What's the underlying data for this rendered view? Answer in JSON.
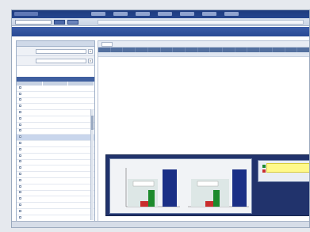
{
  "app": {
    "brand": "",
    "nav": [
      "",
      "",
      "",
      "",
      "",
      "",
      ""
    ]
  },
  "toolbar": {
    "select_value": "",
    "btn1": "",
    "btn2": ""
  },
  "section": {
    "menu": "",
    "title": ""
  },
  "left_panel": {
    "header": "",
    "filters": [
      {
        "label": "",
        "value": ""
      },
      {
        "label": "",
        "value": ""
      }
    ],
    "list_header": "",
    "columns": [
      "",
      "",
      ""
    ],
    "rows": [
      {
        "a": "",
        "b": ""
      },
      {
        "a": "",
        "b": ""
      },
      {
        "a": "",
        "b": ""
      },
      {
        "a": "",
        "b": ""
      },
      {
        "a": "",
        "b": ""
      },
      {
        "a": "",
        "b": ""
      },
      {
        "a": "",
        "b": ""
      },
      {
        "a": "",
        "b": ""
      },
      {
        "a": "",
        "b": ""
      },
      {
        "a": "",
        "b": ""
      },
      {
        "a": "",
        "b": ""
      },
      {
        "a": "",
        "b": ""
      },
      {
        "a": "",
        "b": ""
      },
      {
        "a": "",
        "b": ""
      },
      {
        "a": "",
        "b": ""
      },
      {
        "a": "",
        "b": ""
      },
      {
        "a": "",
        "b": ""
      },
      {
        "a": "",
        "b": ""
      },
      {
        "a": "",
        "b": ""
      },
      {
        "a": "",
        "b": ""
      },
      {
        "a": "",
        "b": ""
      },
      {
        "a": "",
        "b": ""
      }
    ],
    "selected_row": 8
  },
  "grid": {
    "tab": "",
    "pager": "",
    "columns": [
      "",
      "",
      "",
      "",
      "",
      "",
      "",
      "",
      "",
      "",
      "",
      "",
      "",
      "",
      "",
      "",
      ""
    ],
    "row": [
      "",
      "",
      "",
      "",
      "",
      "",
      "",
      "",
      "",
      "",
      "",
      "",
      "",
      "",
      "",
      "",
      ""
    ]
  },
  "chart": {
    "title": "",
    "colors": {
      "navy": "#1a2f86",
      "green": "#1c8a2c",
      "red": "#c92d2d",
      "yellow": "#fff98a"
    }
  },
  "status": {
    "left": "",
    "right": ""
  }
}
